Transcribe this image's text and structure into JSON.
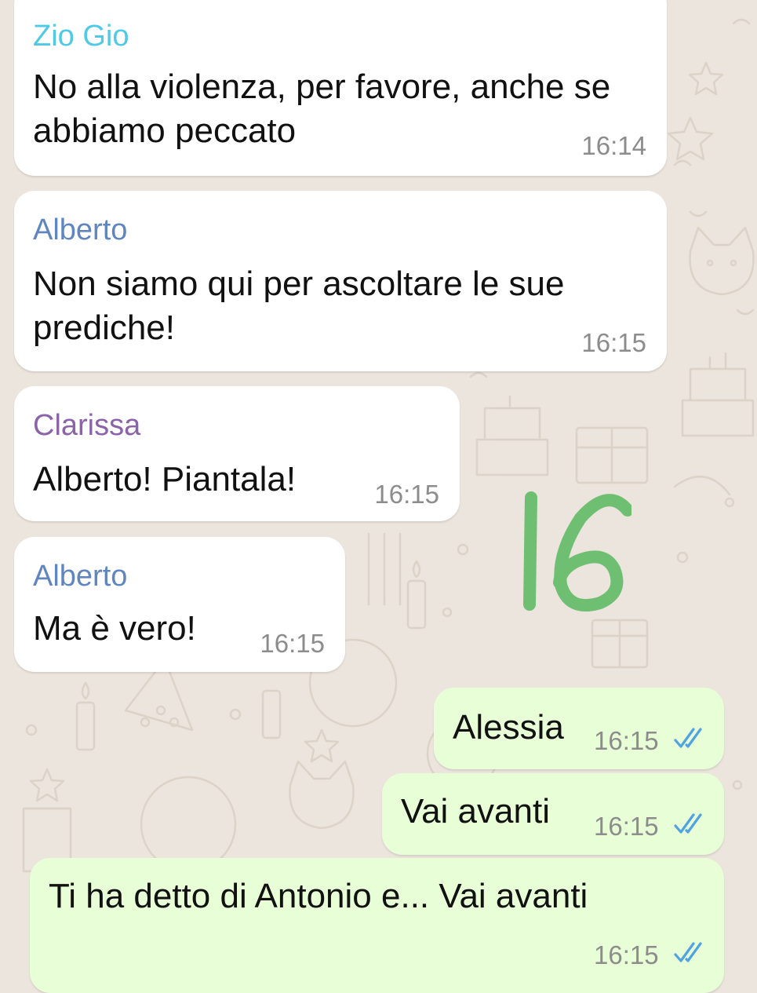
{
  "colors": {
    "background": "#ece5dd",
    "incoming_bubble": "#ffffff",
    "outgoing_bubble": "#e7fed6",
    "read_ticks": "#4fa3e2",
    "handwritten_number": "#6fbf73"
  },
  "handwritten_overlay": {
    "text": "16"
  },
  "messages": [
    {
      "direction": "incoming",
      "sender": "Zio Gio",
      "sender_color": "#4ec9e6",
      "lines": [
        "No alla violenza, per favore, anche se",
        "abbiamo peccato"
      ],
      "time": "16:14"
    },
    {
      "direction": "incoming",
      "sender": "Alberto",
      "sender_color": "#5f86bf",
      "lines": [
        "Non siamo qui per ascoltare le sue",
        "prediche!"
      ],
      "time": "16:15"
    },
    {
      "direction": "incoming",
      "sender": "Clarissa",
      "sender_color": "#8a63a8",
      "lines": [
        "Alberto! Piantala!"
      ],
      "time": "16:15"
    },
    {
      "direction": "incoming",
      "sender": "Alberto",
      "sender_color": "#5f86bf",
      "lines": [
        "Ma è vero!"
      ],
      "time": "16:15"
    },
    {
      "direction": "outgoing",
      "lines": [
        "Alessia"
      ],
      "time": "16:15",
      "status_icon": "double-check-read-icon"
    },
    {
      "direction": "outgoing",
      "lines": [
        "Vai avanti"
      ],
      "time": "16:15",
      "status_icon": "double-check-read-icon"
    },
    {
      "direction": "outgoing",
      "lines": [
        "Ti ha detto di Antonio e... Vai avanti"
      ],
      "time": "16:15",
      "status_icon": "double-check-read-icon"
    }
  ]
}
